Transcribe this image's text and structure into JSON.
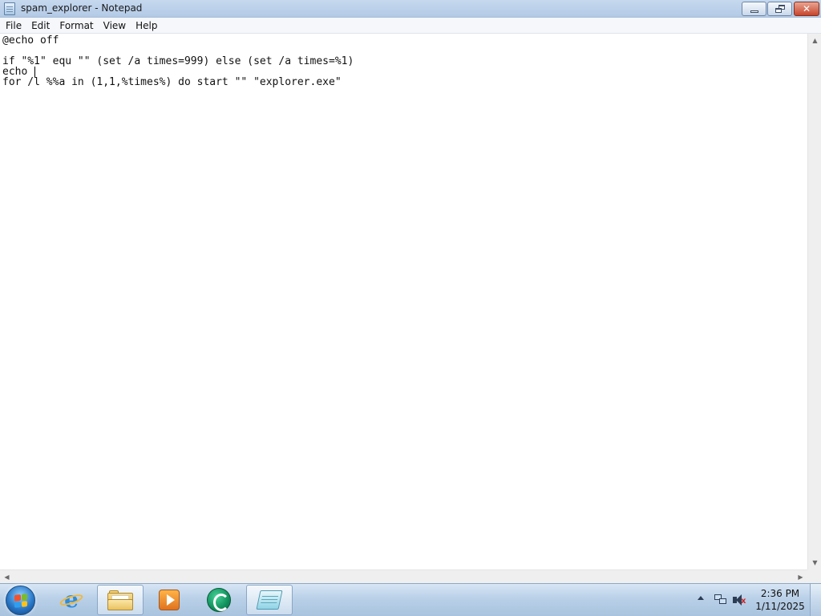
{
  "window": {
    "title": "spam_explorer - Notepad",
    "icon": "notepad-icon"
  },
  "controls": {
    "minimize": "minimize-icon",
    "maximize": "restore-icon",
    "close_glyph": "✕"
  },
  "menu": [
    {
      "label": "File"
    },
    {
      "label": "Edit"
    },
    {
      "label": "Format"
    },
    {
      "label": "View"
    },
    {
      "label": "Help"
    }
  ],
  "editor": {
    "lines": [
      "@echo off",
      "",
      "if \"%1\" equ \"\" (set /a times=999) else (set /a times=%1)",
      "echo ",
      "for /l %%a in (1,1,%times%) do start \"\" \"explorer.exe\""
    ]
  },
  "taskbar": {
    "start": "start-orb-icon",
    "pinned": [
      {
        "name": "internet-explorer-icon"
      },
      {
        "name": "windows-explorer-icon"
      },
      {
        "name": "media-player-icon"
      },
      {
        "name": "green-app-icon"
      },
      {
        "name": "notepad-icon",
        "active": true
      }
    ]
  },
  "tray": {
    "time": "2:36 PM",
    "date": "1/11/2025"
  },
  "colors": {
    "titlebar": "#c5d8ee",
    "taskbar": "#b9d0e8",
    "close_button": "#c8462c"
  }
}
